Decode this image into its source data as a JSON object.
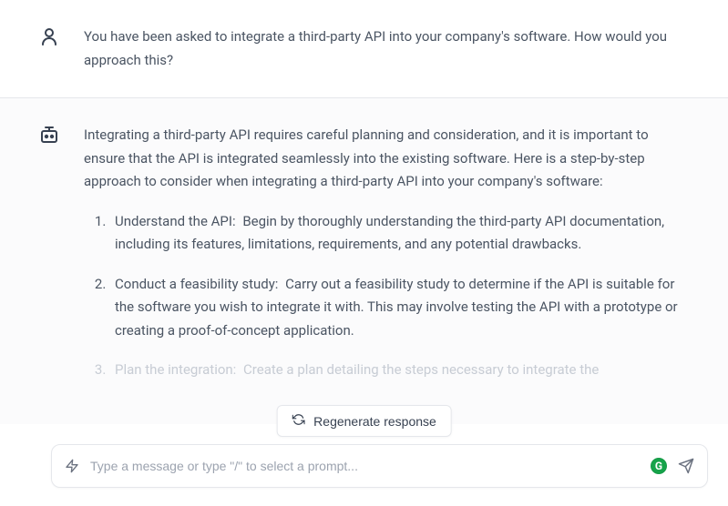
{
  "user_message": "You have been asked to integrate a third-party API into your company's software. How would you approach this?",
  "assistant_intro": "Integrating a third-party API requires careful planning and consideration, and it is important to ensure that the API is integrated seamlessly into the existing software. Here is a step-by-step approach to consider when integrating a third-party API into your company's software:",
  "assistant_steps": {
    "s1_label": "Understand the API:",
    "s1_text": " Begin by thoroughly understanding the third-party API documentation, including its features, limitations, requirements, and any potential drawbacks.",
    "s2_label": "Conduct a feasibility study:",
    "s2_text": " Carry out a feasibility study to determine if the API is suitable for the software you wish to integrate it with. This may involve testing the API with a prototype or creating a proof-of-concept application.",
    "s3_label": "Plan the integration:",
    "s3_text": " Create a plan detailing the steps necessary to integrate the"
  },
  "regenerate_label": "Regenerate response",
  "input_placeholder": "Type a message or type \"/\" to select a prompt...",
  "grammarly_badge": "G"
}
